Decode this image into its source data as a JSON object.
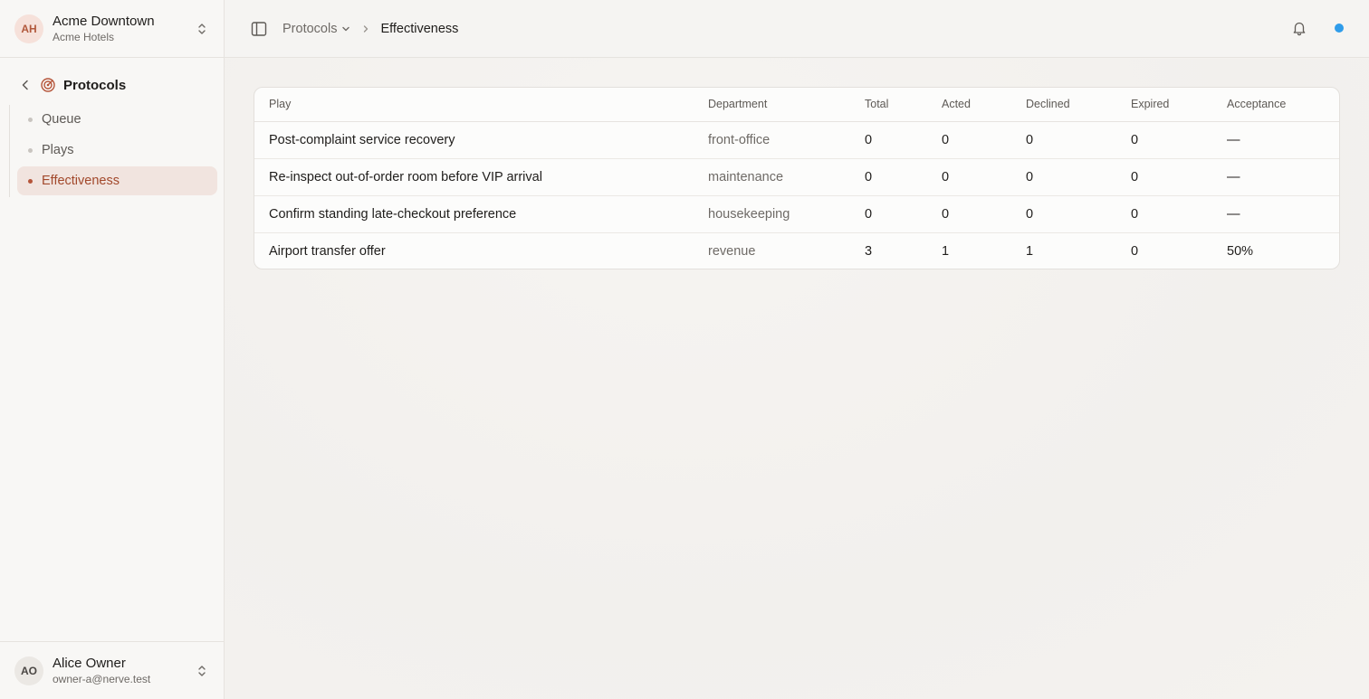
{
  "org": {
    "initials": "AH",
    "name": "Acme Downtown",
    "subtitle": "Acme Hotels"
  },
  "nav": {
    "section_label": "Protocols",
    "items": [
      {
        "label": "Queue",
        "active": false
      },
      {
        "label": "Plays",
        "active": false
      },
      {
        "label": "Effectiveness",
        "active": true
      }
    ]
  },
  "user": {
    "initials": "AO",
    "name": "Alice Owner",
    "email": "owner-a@nerve.test"
  },
  "header": {
    "breadcrumb_parent": "Protocols",
    "breadcrumb_current": "Effectiveness",
    "status_color": "#2f9cea"
  },
  "table": {
    "columns": [
      "Play",
      "Department",
      "Total",
      "Acted",
      "Declined",
      "Expired",
      "Acceptance"
    ],
    "rows": [
      {
        "play": "Post-complaint service recovery",
        "department": "front-office",
        "total": "0",
        "acted": "0",
        "declined": "0",
        "expired": "0",
        "acceptance": "—"
      },
      {
        "play": "Re-inspect out-of-order room before VIP arrival",
        "department": "maintenance",
        "total": "0",
        "acted": "0",
        "declined": "0",
        "expired": "0",
        "acceptance": "—"
      },
      {
        "play": "Confirm standing late-checkout preference",
        "department": "housekeeping",
        "total": "0",
        "acted": "0",
        "declined": "0",
        "expired": "0",
        "acceptance": "—"
      },
      {
        "play": "Airport transfer offer",
        "department": "revenue",
        "total": "3",
        "acted": "1",
        "declined": "1",
        "expired": "0",
        "acceptance": "50%"
      }
    ]
  },
  "colors": {
    "accent": "#b5553a",
    "active_bg": "#f1e4df"
  }
}
